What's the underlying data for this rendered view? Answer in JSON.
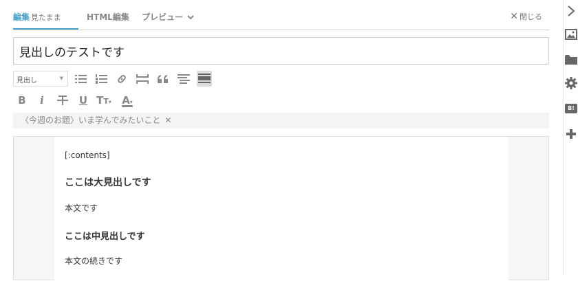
{
  "tabs": {
    "edit_label": "編集",
    "edit_sub": "見たまま",
    "html_label": "HTML編集",
    "preview_label": "プレビュー",
    "close_label": "閉じる"
  },
  "title_input": {
    "value": "見出しのテストです"
  },
  "toolbar": {
    "heading_select": "見出し",
    "format": {
      "bold": "B",
      "italic": "i",
      "underline": "U",
      "textsize": "T",
      "color": "A"
    }
  },
  "odai": {
    "text": "〈今週のお題〉いま学んでみたいこと"
  },
  "content": {
    "line1": "[:contents]",
    "line2": "ここは大見出しです",
    "line3": "本文です",
    "line4": "ここは中見出しです",
    "line5": "本文の続きです"
  },
  "sidebar": {
    "hatena_badge": "B!"
  },
  "colors": {
    "accent": "#49a0c5",
    "icon": "#888888",
    "sidebar_icon": "#666666"
  }
}
